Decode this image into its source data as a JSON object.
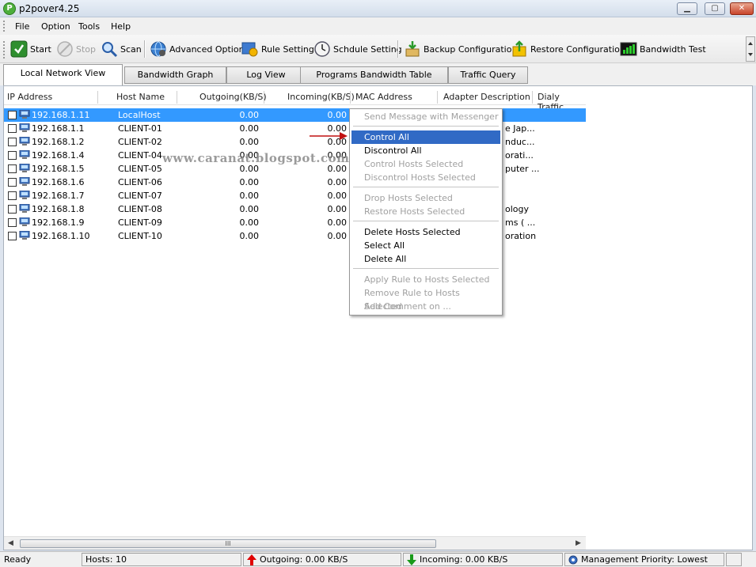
{
  "window": {
    "title": "p2pover4.25"
  },
  "menubar": [
    "File",
    "Option",
    "Tools",
    "Help"
  ],
  "toolbar": {
    "start": "Start",
    "stop": "Stop",
    "scan": "Scan",
    "advanced_option": "Advanced Option",
    "rule_setting": "Rule Setting",
    "schedule_setting": "Schdule Setting",
    "backup_configuration": "Backup Configuration",
    "restore_configuration": "Restore Configuration",
    "bandwidth_test": "Bandwidth Test"
  },
  "tabs": [
    "Local Network View",
    "Bandwidth Graph",
    "Log View",
    "Programs Bandwidth Table",
    "Traffic Query"
  ],
  "table": {
    "columns": [
      "IP Address",
      "Host Name",
      "Outgoing(KB/S)",
      "Incoming(KB/S)",
      "MAC Address",
      "Adapter Description",
      "Dialy Traffic"
    ],
    "rows": [
      {
        "ip": "192.168.1.11",
        "host": "LocalHost",
        "out": "0.00",
        "in": "0.00",
        "adapter": ""
      },
      {
        "ip": "192.168.1.1",
        "host": "CLIENT-01",
        "out": "0.00",
        "in": "0.00",
        "adapter": "e Jap..."
      },
      {
        "ip": "192.168.1.2",
        "host": "CLIENT-02",
        "out": "0.00",
        "in": "0.00",
        "adapter": "nduc..."
      },
      {
        "ip": "192.168.1.4",
        "host": "CLIENT-04",
        "out": "0.00",
        "in": "0.00",
        "adapter": "orati..."
      },
      {
        "ip": "192.168.1.5",
        "host": "CLIENT-05",
        "out": "0.00",
        "in": "0.00",
        "adapter": "puter ..."
      },
      {
        "ip": "192.168.1.6",
        "host": "CLIENT-06",
        "out": "0.00",
        "in": "0.00",
        "adapter": ""
      },
      {
        "ip": "192.168.1.7",
        "host": "CLIENT-07",
        "out": "0.00",
        "in": "0.00",
        "adapter": ""
      },
      {
        "ip": "192.168.1.8",
        "host": "CLIENT-08",
        "out": "0.00",
        "in": "0.00",
        "adapter": "ology"
      },
      {
        "ip": "192.168.1.9",
        "host": "CLIENT-09",
        "out": "0.00",
        "in": "0.00",
        "adapter": "ms ( ..."
      },
      {
        "ip": "192.168.1.10",
        "host": "CLIENT-10",
        "out": "0.00",
        "in": "0.00",
        "adapter": "oration"
      }
    ],
    "scroll_thumb_label": "III"
  },
  "context_menu": {
    "items": [
      {
        "label": "Send Message with Messenger",
        "enabled": false
      },
      {
        "label": "Control All",
        "enabled": true,
        "highlighted": true
      },
      {
        "label": "Discontrol All",
        "enabled": true
      },
      {
        "label": "Control Hosts Selected",
        "enabled": false
      },
      {
        "label": "Discontrol Hosts Selected",
        "enabled": false
      },
      {
        "label": "Drop Hosts Selected",
        "enabled": false
      },
      {
        "label": "Restore Hosts Selected",
        "enabled": false
      },
      {
        "label": "Delete Hosts Selected",
        "enabled": true
      },
      {
        "label": "Select All",
        "enabled": true
      },
      {
        "label": "Delete All",
        "enabled": true
      },
      {
        "label": "Apply Rule to Hosts Selected",
        "enabled": false
      },
      {
        "label": "Remove Rule to Hosts Selected",
        "enabled": false
      },
      {
        "label": "Add Comment on ...",
        "enabled": false
      }
    ]
  },
  "watermark": "www.caranat.blogspot.com",
  "statusbar": {
    "ready": "Ready",
    "hosts": "Hosts: 10",
    "outgoing": "Outgoing: 0.00 KB/S",
    "incoming": "Incoming: 0.00 KB/S",
    "priority": "Management Priority: Lowest"
  },
  "colors": {
    "selection": "#3399ff",
    "menu_highlight": "#316ac5",
    "outgoing_arrow": "#e00000",
    "incoming_arrow": "#1a9a1a"
  }
}
